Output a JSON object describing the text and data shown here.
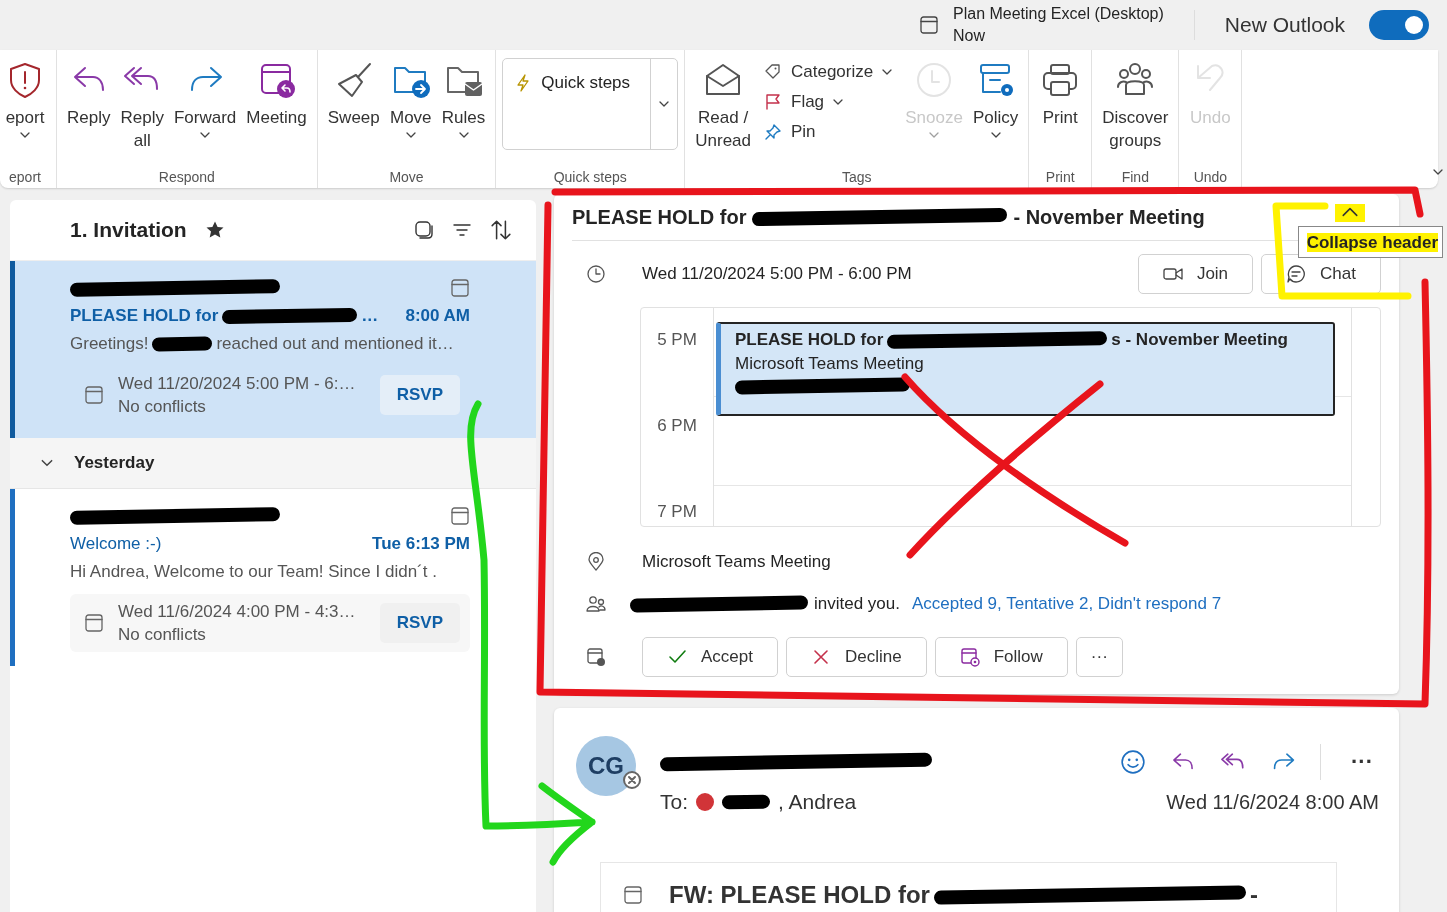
{
  "title_bar": {
    "reminder_title": "Plan Meeting Excel (Desktop)",
    "reminder_time": "Now",
    "new_outlook_label": "New Outlook",
    "new_outlook_on": true
  },
  "ribbon": {
    "groups": [
      {
        "label": "eport",
        "buttons": [
          {
            "kind": "large",
            "label": "eport",
            "dropdown": true,
            "disabled": false
          }
        ]
      },
      {
        "label": "Respond",
        "buttons": [
          {
            "kind": "large",
            "label": "Reply",
            "dropdown": false,
            "disabled": false
          },
          {
            "kind": "large",
            "label": "Reply all",
            "dropdown": false,
            "disabled": false
          },
          {
            "kind": "large",
            "label": "Forward",
            "dropdown": true,
            "disabled": false
          },
          {
            "kind": "large",
            "label": "Meeting",
            "dropdown": false,
            "disabled": false
          }
        ]
      },
      {
        "label": "Move",
        "buttons": [
          {
            "kind": "large",
            "label": "Sweep",
            "dropdown": false,
            "disabled": false
          },
          {
            "kind": "large",
            "label": "Move",
            "dropdown": true,
            "disabled": false
          },
          {
            "kind": "large",
            "label": "Rules",
            "dropdown": true,
            "disabled": false
          }
        ]
      },
      {
        "label": "Quick steps",
        "buttons": [
          {
            "kind": "gallery",
            "label": "Quick steps",
            "dropdown": true
          }
        ]
      },
      {
        "label": "Tags",
        "buttons": [
          {
            "kind": "large",
            "label": "Read / Unread",
            "dropdown": false,
            "disabled": false
          },
          {
            "kind": "stack",
            "items": [
              {
                "label": "Categorize",
                "dropdown": true
              },
              {
                "label": "Flag",
                "dropdown": true
              },
              {
                "label": "Pin",
                "dropdown": false
              }
            ]
          },
          {
            "kind": "large",
            "label": "Snooze",
            "dropdown": true,
            "disabled": true
          },
          {
            "kind": "large",
            "label": "Policy",
            "dropdown": true,
            "disabled": false
          }
        ]
      },
      {
        "label": "Print",
        "buttons": [
          {
            "kind": "large",
            "label": "Print",
            "dropdown": false,
            "disabled": false
          }
        ]
      },
      {
        "label": "Find",
        "buttons": [
          {
            "kind": "large",
            "label": "Discover groups",
            "dropdown": false,
            "disabled": false
          }
        ]
      },
      {
        "label": "Undo",
        "buttons": [
          {
            "kind": "large",
            "label": "Undo",
            "dropdown": false,
            "disabled": true
          }
        ]
      }
    ]
  },
  "message_list": {
    "folder_title": "1. Invitation",
    "items": [
      {
        "selected": true,
        "subject_segments": [
          "PLEASE HOLD for",
          "…"
        ],
        "time": "8:00 AM",
        "preview_segments": [
          "Greetings!",
          "reached out and mentioned it…"
        ],
        "meeting_time": "Wed 11/20/2024 5:00 PM - 6:…",
        "conflicts": "No conflicts",
        "rsvp": "RSVP"
      }
    ],
    "groups": [
      {
        "label": "Yesterday",
        "expanded": true,
        "items": [
          {
            "selected": false,
            "subject_segments": [
              "Welcome :-)"
            ],
            "time": "Tue 6:13 PM",
            "preview_segments": [
              "Hi Andrea, Welcome to our Team! Since I didn´t ."
            ],
            "meeting_time": "Wed 11/6/2024 4:00 PM - 4:3…",
            "conflicts": "No conflicts",
            "rsvp": "RSVP"
          }
        ]
      }
    ]
  },
  "invitation": {
    "title_segments": [
      "PLEASE HOLD for",
      "- November Meeting"
    ],
    "tooltip": "Collapse header",
    "time": "Wed 11/20/2024 5:00 PM - 6:00 PM",
    "join": "Join",
    "chat": "Chat",
    "calendar": {
      "hours": [
        "5 PM",
        "6 PM",
        "7 PM"
      ],
      "event_title_segments": [
        "PLEASE HOLD for",
        "s - November Meeting"
      ],
      "event_location": "Microsoft Teams Meeting"
    },
    "location": "Microsoft Teams Meeting",
    "invited_text": "invited you.",
    "responses_link": "Accepted 9, Tentative 2, Didn't respond 7",
    "actions": [
      "Accept",
      "Decline",
      "Follow",
      "···"
    ]
  },
  "message": {
    "avatar_initials": "CG",
    "to_label": "To:",
    "recipient_suffix": ", Andrea",
    "date": "Wed 11/6/2024 8:00 AM",
    "more": "···",
    "attachment_title_segments": [
      "FW: PLEASE HOLD for",
      "-"
    ]
  }
}
